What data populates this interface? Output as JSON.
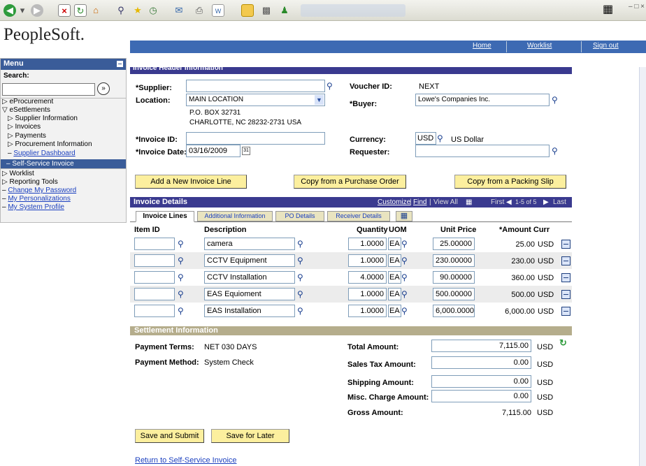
{
  "browser": {
    "icons": [
      "back-icon",
      "forward-icon",
      "stop-icon",
      "refresh-icon",
      "home-icon",
      "search-icon",
      "favorites-icon",
      "history-icon",
      "mail-icon",
      "print-icon",
      "edit-icon",
      "folder-icon",
      "research-icon",
      "messenger-icon"
    ]
  },
  "header": {
    "logo": "PeopleSoft.",
    "nav": {
      "home": "Home",
      "worklist": "Worklist",
      "signout": "Sign out"
    }
  },
  "sidebar": {
    "title": "Menu",
    "search_label": "Search:",
    "items": {
      "eprocurement": "eProcurement",
      "esettlements": "eSettlements",
      "supplier_info": "Supplier Information",
      "invoices": "Invoices",
      "payments": "Payments",
      "procurement_info": "Procurement Information",
      "supplier_dashboard": "Supplier Dashboard",
      "self_service_invoice": "Self-Service Invoice",
      "worklist": "Worklist",
      "reporting_tools": "Reporting Tools",
      "change_password": "Change My Password",
      "personalizations": "My Personalizations",
      "system_profile": "My System Profile"
    }
  },
  "header_info": {
    "section_title": "Invoice Header Information",
    "supplier_label": "*Supplier:",
    "supplier_value": "",
    "location_label": "Location:",
    "location_value": "MAIN LOCATION",
    "address_line1": "P.O. BOX 32731",
    "address_line2": "CHARLOTTE, NC  28232-2731  USA",
    "voucher_label": "Voucher ID:",
    "voucher_value": "NEXT",
    "buyer_label": "*Buyer:",
    "buyer_value": "Lowe's Companies Inc.",
    "invoice_id_label": "*Invoice ID:",
    "invoice_id_value": "",
    "invoice_date_label": "*Invoice Date:",
    "invoice_date_value": "03/16/2009",
    "currency_label": "Currency:",
    "currency_code": "USD",
    "currency_name": "US Dollar",
    "requester_label": "Requester:",
    "requester_value": ""
  },
  "actions": {
    "add_line": "Add a New Invoice Line",
    "copy_po": "Copy from a Purchase Order",
    "copy_slip": "Copy from a Packing Slip"
  },
  "details": {
    "title": "Invoice Details",
    "customize": "Customize",
    "find": "Find",
    "view_all": "View All",
    "first": "First",
    "range": "1-5 of 5",
    "last": "Last",
    "tabs": [
      "Invoice Lines",
      "Additional Information",
      "PO Details",
      "Receiver Details"
    ],
    "columns": {
      "item": "Item ID",
      "desc": "Description",
      "qty": "Quantity",
      "uom": "UOM",
      "price": "Unit Price",
      "amount": "*Amount Curr"
    },
    "rows": [
      {
        "item": "",
        "desc": "camera",
        "qty": "1.0000",
        "uom": "EA",
        "price": "25.00000",
        "amount": "25.00",
        "curr": "USD"
      },
      {
        "item": "",
        "desc": "CCTV Equipment",
        "qty": "1.0000",
        "uom": "EA",
        "price": "230.00000",
        "amount": "230.00",
        "curr": "USD"
      },
      {
        "item": "",
        "desc": "CCTV Installation",
        "qty": "4.0000",
        "uom": "EA",
        "price": "90.00000",
        "amount": "360.00",
        "curr": "USD"
      },
      {
        "item": "",
        "desc": "EAS Equioment",
        "qty": "1.0000",
        "uom": "EA",
        "price": "500.00000",
        "amount": "500.00",
        "curr": "USD"
      },
      {
        "item": "",
        "desc": "EAS Installation",
        "qty": "1.0000",
        "uom": "EA",
        "price": "6,000.00000",
        "amount": "6,000.00",
        "curr": "USD"
      }
    ]
  },
  "settlement": {
    "title": "Settlement Information",
    "terms_label": "Payment Terms:",
    "terms_value": "NET 030 DAYS",
    "method_label": "Payment Method:",
    "method_value": "System Check",
    "total_label": "Total Amount:",
    "total_value": "7,115.00",
    "sales_tax_label": "Sales Tax Amount:",
    "sales_tax_value": "0.00",
    "shipping_label": "Shipping Amount:",
    "shipping_value": "0.00",
    "misc_label": "Misc. Charge Amount:",
    "misc_value": "0.00",
    "gross_label": "Gross Amount:",
    "gross_value": "7,115.00",
    "currency": "USD"
  },
  "footer": {
    "save_submit": "Save and Submit",
    "save_later": "Save for Later",
    "return_link": "Return to Self-Service Invoice"
  },
  "colors": {
    "nav_blue": "#3d6ab3",
    "section_blue": "#3a3a8f",
    "button_yellow": "#fcef9e",
    "settle_tan": "#b5ad8c"
  }
}
